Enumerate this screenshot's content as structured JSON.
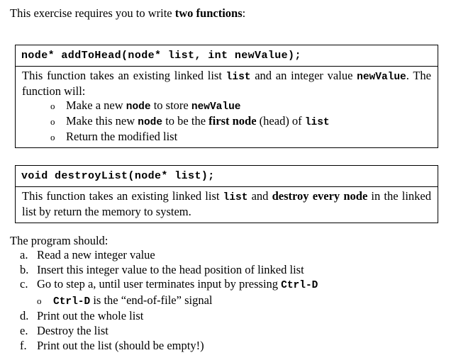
{
  "document": {
    "intro_before_bold": "This exercise requires you to write ",
    "intro_bold": "two functions",
    "intro_after_bold": ":"
  },
  "boxes": [
    {
      "name": "addToHead",
      "signature": "node* addToHead(node* list, int newValue);",
      "body_run_1": "This function takes an existing linked list ",
      "body_code_1": "list",
      "body_run_2": " and an integer value ",
      "body_code_2": "newValue",
      "body_run_3": ". The function will:",
      "bullets": [
        {
          "seg_1": "Make a new ",
          "code_1": "node",
          "seg_2": " to store ",
          "code_2": "newValue",
          "seg_3": ""
        },
        {
          "seg_1": "Make this new ",
          "code_1": "node",
          "seg_2": " to be the ",
          "bold_1": "first node",
          "seg_3": " (head) of ",
          "code_3": "list"
        },
        {
          "seg_1": "Return the modified list"
        }
      ]
    },
    {
      "name": "destroyList",
      "signature": "void destroyList(node* list);",
      "body_run_1": "This function takes an existing linked list ",
      "body_code_1": "list",
      "body_run_2": " and ",
      "body_bold_1": "destroy every node",
      "body_run_3": " in the linked list by return the memory to system."
    }
  ],
  "program": {
    "heading": "The program should:",
    "steps": [
      {
        "label": "a.",
        "text": "Read a new integer value"
      },
      {
        "label": "b.",
        "text": "Insert this integer value to the head position of linked list"
      },
      {
        "label": "c.",
        "text_before": "Go to step a, until user terminates input by pressing ",
        "code": "Ctrl-D",
        "sub": {
          "code": "Ctrl-D",
          "text_after": " is the “end-of-file” signal"
        }
      },
      {
        "label": "d.",
        "text": "Print out the whole list"
      },
      {
        "label": "e.",
        "text": "Destroy the list"
      },
      {
        "label": "f.",
        "text": "Print out the list (should be empty!)"
      }
    ]
  }
}
